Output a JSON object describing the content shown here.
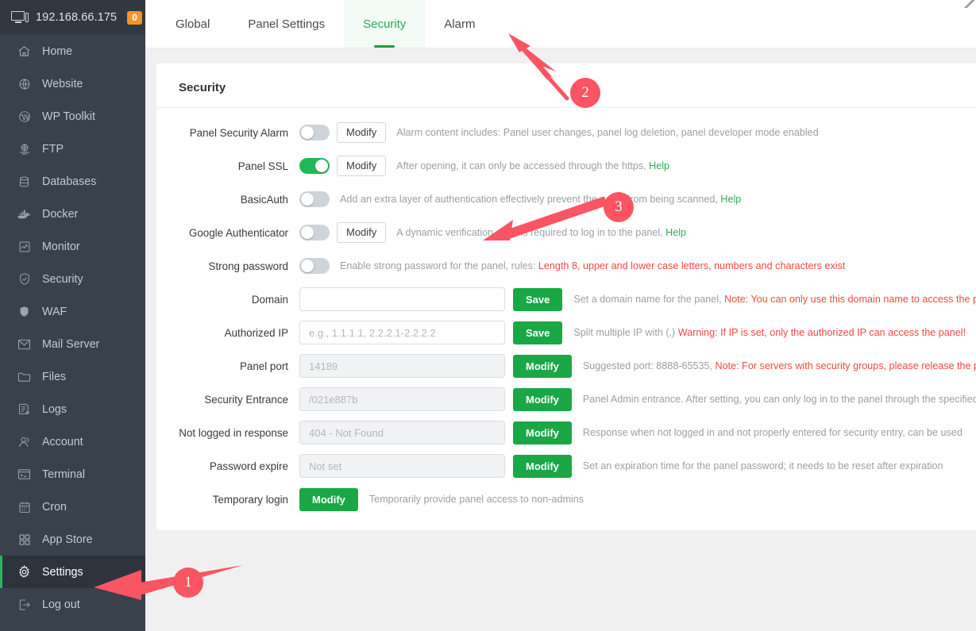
{
  "sidebar": {
    "brand": {
      "ip": "192.168.66.175",
      "badge": "0",
      "icon": "monitor-icon"
    },
    "items": [
      {
        "label": "Home",
        "icon": "home-icon",
        "active": false
      },
      {
        "label": "Website",
        "icon": "globe-icon",
        "active": false
      },
      {
        "label": "WP Toolkit",
        "icon": "wordpress-icon",
        "active": false
      },
      {
        "label": "FTP",
        "icon": "ftp-icon",
        "active": false
      },
      {
        "label": "Databases",
        "icon": "database-icon",
        "active": false
      },
      {
        "label": "Docker",
        "icon": "docker-icon",
        "active": false
      },
      {
        "label": "Monitor",
        "icon": "chart-icon",
        "active": false
      },
      {
        "label": "Security",
        "icon": "shield-check-icon",
        "active": false
      },
      {
        "label": "WAF",
        "icon": "shield-icon",
        "active": false
      },
      {
        "label": "Mail Server",
        "icon": "mail-icon",
        "active": false
      },
      {
        "label": "Files",
        "icon": "folder-icon",
        "active": false
      },
      {
        "label": "Logs",
        "icon": "log-icon",
        "active": false
      },
      {
        "label": "Account",
        "icon": "user-icon",
        "active": false
      },
      {
        "label": "Terminal",
        "icon": "terminal-icon",
        "active": false
      },
      {
        "label": "Cron",
        "icon": "calendar-icon",
        "active": false
      },
      {
        "label": "App Store",
        "icon": "grid-icon",
        "active": false
      },
      {
        "label": "Settings",
        "icon": "gear-icon",
        "active": true
      },
      {
        "label": "Log out",
        "icon": "logout-icon",
        "active": false
      }
    ]
  },
  "tabs": [
    {
      "label": "Global",
      "active": false
    },
    {
      "label": "Panel Settings",
      "active": false
    },
    {
      "label": "Security",
      "active": true
    },
    {
      "label": "Alarm",
      "active": false
    }
  ],
  "card": {
    "title": "Security",
    "rows": [
      {
        "label": "Panel Security Alarm",
        "type": "toggle",
        "toggle_on": false,
        "button": "Modify",
        "button_style": "ghost",
        "desc_plain": "Alarm content includes: Panel user changes, panel log deletion, panel developer mode enabled",
        "desc_red": "",
        "help": ""
      },
      {
        "label": "Panel SSL",
        "type": "toggle",
        "toggle_on": true,
        "button": "Modify",
        "button_style": "ghost",
        "desc_plain": "After opening, it can only be accessed through the https,",
        "desc_red": "",
        "help": "Help"
      },
      {
        "label": "BasicAuth",
        "type": "toggle",
        "toggle_on": false,
        "button": "",
        "button_style": "",
        "desc_plain": "Add an extra layer of authentication effectively prevent the panel from being scanned,",
        "desc_red": "",
        "help": "Help"
      },
      {
        "label": "Google Authenticator",
        "type": "toggle",
        "toggle_on": false,
        "button": "Modify",
        "button_style": "ghost",
        "desc_plain": "A dynamic verification code is required to log in to the panel,",
        "desc_red": "",
        "help": "Help"
      },
      {
        "label": "Strong password",
        "type": "toggle",
        "toggle_on": false,
        "button": "",
        "button_style": "",
        "desc_plain": "Enable strong password for the panel, rules:",
        "desc_red": "Length 8, upper and lower case letters, numbers and characters exist",
        "help": ""
      },
      {
        "label": "Domain",
        "type": "input",
        "value": "",
        "placeholder": "",
        "disabled": false,
        "button": "Save",
        "button_style": "green",
        "desc_plain": "Set a domain name for the panel,",
        "desc_red": "Note: You can only use this domain name to access the panel",
        "help": ""
      },
      {
        "label": "Authorized IP",
        "type": "input",
        "value": "",
        "placeholder": "e.g., 1.1.1.1, 2.2.2.1-2.2.2.2",
        "disabled": false,
        "button": "Save",
        "button_style": "green",
        "desc_plain": "Split multiple IP with (,)",
        "desc_red": "Warning: If IP is set, only the authorized IP can access the panel!",
        "help": ""
      },
      {
        "label": "Panel port",
        "type": "input",
        "value": "",
        "placeholder": "14189",
        "disabled": true,
        "button": "Modify",
        "button_style": "green",
        "desc_plain": "Suggested port: 8888-65535,",
        "desc_red": "Note: For servers with security groups, please release the port",
        "help": ""
      },
      {
        "label": "Security Entrance",
        "type": "input",
        "value": "",
        "placeholder": "/021e887b",
        "disabled": true,
        "button": "Modify",
        "button_style": "green",
        "desc_plain": "Panel Admin entrance. After setting, you can only log in to the panel through the specified entrance",
        "desc_red": "",
        "help": ""
      },
      {
        "label": "Not logged in response",
        "type": "input",
        "value": "",
        "placeholder": "404 - Not Found",
        "disabled": true,
        "button": "Modify",
        "button_style": "green",
        "desc_plain": "Response when not logged in and not properly entered for security entry, can be used",
        "desc_red": "",
        "help": ""
      },
      {
        "label": "Password expire",
        "type": "input",
        "value": "",
        "placeholder": "Not set",
        "disabled": true,
        "button": "Modify",
        "button_style": "green",
        "desc_plain": "Set an expiration time for the panel password; it needs to be reset after expiration",
        "desc_red": "",
        "help": ""
      },
      {
        "label": "Temporary login",
        "type": "button-only",
        "button": "Modify",
        "button_style": "green",
        "desc_plain": "Temporarily provide panel access to non-admins",
        "desc_red": "",
        "help": ""
      }
    ]
  },
  "annotations": [
    {
      "number": "1",
      "target": "sidebar-item-settings",
      "color": "#fb5463"
    },
    {
      "number": "2",
      "target": "tab-security",
      "color": "#fb5463"
    },
    {
      "number": "3",
      "target": "google-authenticator-modify-button",
      "color": "#fb5463"
    }
  ],
  "colors": {
    "accent_green": "#1aa845",
    "toggle_on": "#20b955",
    "sidebar_bg": "#39414d",
    "annotation": "#fb5463",
    "warning_red": "#f04a3f",
    "badge_orange": "#f59426"
  }
}
